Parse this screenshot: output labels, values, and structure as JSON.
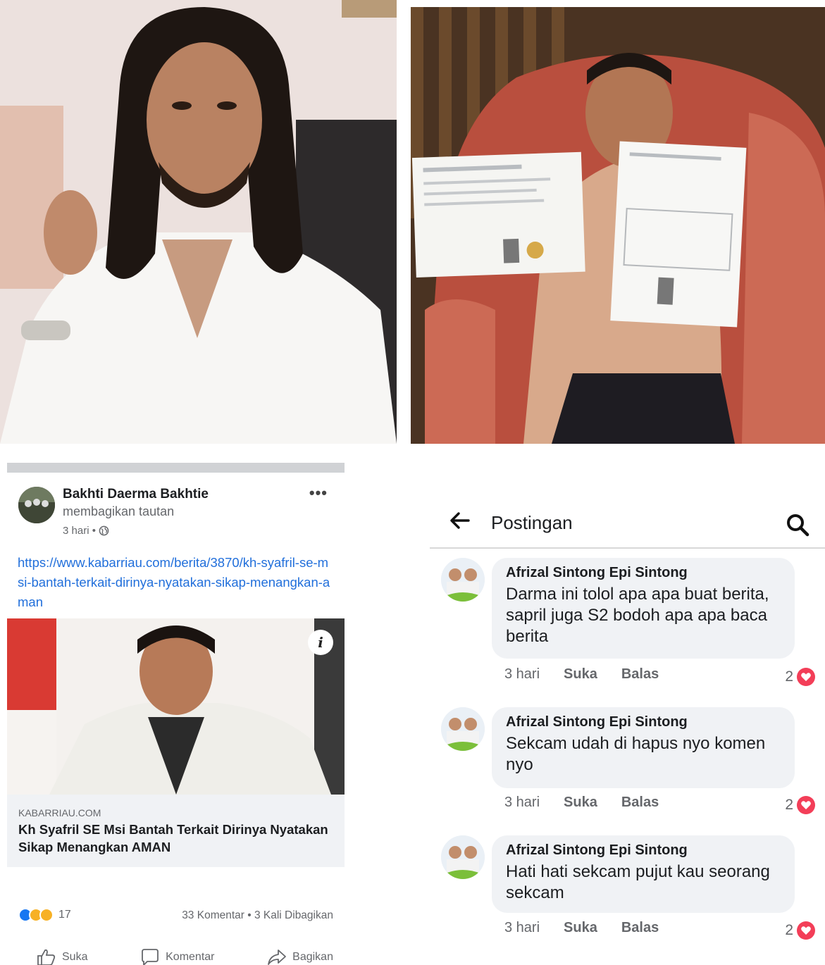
{
  "post": {
    "author": "Bakhti Daerma Bakhtie",
    "action": "membagikan tautan",
    "time": "3 hari •",
    "link": "https://www.kabarriau.com/berita/3870/kh-syafril-se-msi-bantah-terkait-dirinya-nyatakan-sikap-menangkan-aman",
    "preview_domain": "KABARRIAU.COM",
    "preview_title": "Kh Syafril SE Msi Bantah Terkait Dirinya Nyatakan Sikap Menangkan AMAN",
    "reaction_count": "17",
    "stats": "33 Komentar • 3 Kali Dibagikan",
    "actions": {
      "like": "Suka",
      "comment": "Komentar",
      "share": "Bagikan"
    },
    "more_icon": "•••",
    "info_icon": "i"
  },
  "comments_panel": {
    "title": "Postingan",
    "comments": [
      {
        "name": "Afrizal Sintong Epi Sintong",
        "text": "Darma ini tolol apa apa buat berita, sapril juga S2 bodoh apa apa baca berita",
        "time": "3 hari",
        "like": "Suka",
        "reply": "Balas",
        "likes": "2"
      },
      {
        "name": "Afrizal Sintong Epi Sintong",
        "text": "Sekcam udah di hapus nyo komen nyo",
        "time": "3 hari",
        "like": "Suka",
        "reply": "Balas",
        "likes": "2"
      },
      {
        "name": "Afrizal Sintong Epi Sintong",
        "text": "Hati hati sekcam pujut kau seorang sekcam",
        "time": "3 hari",
        "like": "Suka",
        "reply": "Balas",
        "likes": "2"
      }
    ]
  },
  "colors": {
    "link": "#216fdb",
    "like_blue": "#1877f2",
    "love_red": "#f33e58",
    "bubble": "#f0f2f5"
  }
}
